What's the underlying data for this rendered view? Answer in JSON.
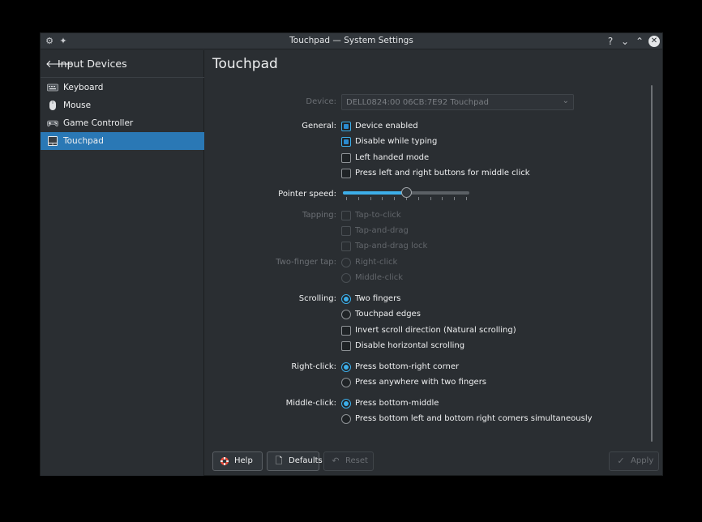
{
  "window": {
    "title": "Touchpad — System Settings"
  },
  "titlebar": {
    "app_icon": "gear-icon",
    "pin_icon": "pin-icon",
    "help": "?",
    "minimize": "⌄",
    "maximize": "⌃",
    "close": "✕"
  },
  "sidebar": {
    "back_icon": "arrow-left-icon",
    "heading": "Input Devices",
    "items": [
      {
        "label": "Keyboard",
        "icon": "keyboard-icon"
      },
      {
        "label": "Mouse",
        "icon": "mouse-icon"
      },
      {
        "label": "Game Controller",
        "icon": "gamepad-icon"
      },
      {
        "label": "Touchpad",
        "icon": "touchpad-icon",
        "active": true
      }
    ]
  },
  "main": {
    "title": "Touchpad",
    "device": {
      "label": "Device:",
      "value": "DELL0824:00 06CB:7E92 Touchpad"
    },
    "general": {
      "label": "General:",
      "options": [
        {
          "label": "Device enabled",
          "checked": true
        },
        {
          "label": "Disable while typing",
          "checked": true
        },
        {
          "label": "Left handed mode",
          "checked": false
        },
        {
          "label": "Press left and right buttons for middle click",
          "checked": false
        }
      ]
    },
    "pointer_speed": {
      "label": "Pointer speed:",
      "value": 0.5
    },
    "tapping": {
      "label": "Tapping:",
      "options": [
        {
          "label": "Tap-to-click",
          "checked": false
        },
        {
          "label": "Tap-and-drag",
          "checked": false
        },
        {
          "label": "Tap-and-drag lock",
          "checked": false
        }
      ]
    },
    "two_finger_tap": {
      "label": "Two-finger tap:",
      "options": [
        {
          "label": "Right-click",
          "checked": false
        },
        {
          "label": "Middle-click",
          "checked": false
        }
      ]
    },
    "scrolling": {
      "label": "Scrolling:",
      "radios": [
        {
          "label": "Two fingers",
          "checked": true
        },
        {
          "label": "Touchpad edges",
          "checked": false
        }
      ],
      "checks": [
        {
          "label": "Invert scroll direction (Natural scrolling)",
          "checked": false
        },
        {
          "label": "Disable horizontal scrolling",
          "checked": false
        }
      ]
    },
    "right_click": {
      "label": "Right-click:",
      "options": [
        {
          "label": "Press bottom-right corner",
          "checked": true
        },
        {
          "label": "Press anywhere with two fingers",
          "checked": false
        }
      ]
    },
    "middle_click": {
      "label": "Middle-click:",
      "options": [
        {
          "label": "Press bottom-middle",
          "checked": true
        },
        {
          "label": "Press bottom left and bottom right corners simultaneously",
          "checked": false
        }
      ]
    }
  },
  "footer": {
    "help": "Help",
    "defaults": "Defaults",
    "reset": "Reset",
    "apply": "Apply"
  },
  "colors": {
    "accent": "#3daee9",
    "selection": "#2a78b5",
    "background": "#2a2e32"
  }
}
